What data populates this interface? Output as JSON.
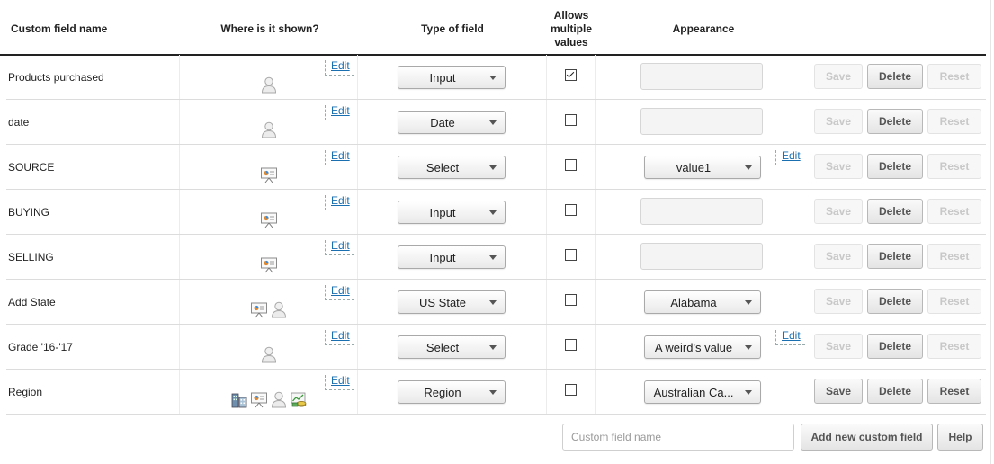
{
  "header": {
    "custom_field_name": "Custom field name",
    "where_shown": "Where is it shown?",
    "type_of_field": "Type of field",
    "allows_multiple": "Allows\nmultiple\nvalues",
    "appearance": "Appearance"
  },
  "labels": {
    "edit": "Edit",
    "save": "Save",
    "delete": "Delete",
    "reset": "Reset"
  },
  "rows": [
    {
      "name": "Products purchased",
      "icons": [
        "person-icon"
      ],
      "type": "Input",
      "multiple": true,
      "appearance": "",
      "save_enabled": false,
      "reset_enabled": false
    },
    {
      "name": "date",
      "icons": [
        "person-icon"
      ],
      "type": "Date",
      "multiple": false,
      "appearance": "",
      "save_enabled": false,
      "reset_enabled": false
    },
    {
      "name": "SOURCE",
      "icons": [
        "presentation-icon"
      ],
      "type": "Select",
      "multiple": false,
      "appearance": "value1",
      "appearance_edit": true,
      "save_enabled": false,
      "reset_enabled": false
    },
    {
      "name": "BUYING",
      "icons": [
        "presentation-icon"
      ],
      "type": "Input",
      "multiple": false,
      "appearance": "",
      "save_enabled": false,
      "reset_enabled": false
    },
    {
      "name": "SELLING",
      "icons": [
        "presentation-icon"
      ],
      "type": "Input",
      "multiple": false,
      "appearance": "",
      "save_enabled": false,
      "reset_enabled": false
    },
    {
      "name": "Add State",
      "icons": [
        "presentation-icon",
        "person-icon"
      ],
      "type": "US State",
      "multiple": false,
      "appearance": "Alabama",
      "save_enabled": false,
      "reset_enabled": false
    },
    {
      "name": "Grade '16-'17",
      "icons": [
        "person-icon"
      ],
      "type": "Select",
      "multiple": false,
      "appearance": "A weird's value",
      "appearance_edit": true,
      "save_enabled": false,
      "reset_enabled": false
    },
    {
      "name": "Region",
      "icons": [
        "building-icon",
        "presentation-icon",
        "person-icon",
        "money-chart-icon"
      ],
      "type": "Region",
      "multiple": false,
      "appearance": "Australian Ca...",
      "save_enabled": true,
      "reset_enabled": true
    }
  ],
  "footer": {
    "input_placeholder": "Custom field name",
    "add_button": "Add new custom field",
    "help_button": "Help"
  },
  "colors": {
    "link": "#1a6fb0",
    "header_rule": "#222222",
    "row_border": "#dcdcdc"
  }
}
